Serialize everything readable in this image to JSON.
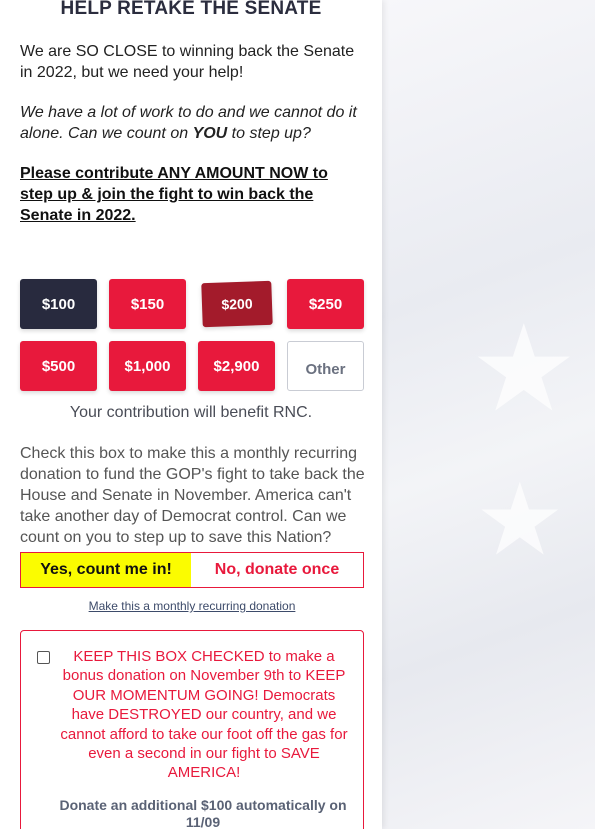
{
  "header": {
    "title": "HELP RETAKE THE SENATE"
  },
  "intro": {
    "paragraph1": "We are SO CLOSE to winning back the Senate in 2022, but we need your help!",
    "paragraph2_pre": "We have a lot of work to do and we cannot do it alone. Can we count on ",
    "paragraph2_you": "YOU",
    "paragraph2_post": " to step up?",
    "cta": "Please contribute ANY AMOUNT NOW to step up & join the fight to win back the Senate in 2022."
  },
  "amounts": {
    "a100": "$100",
    "a150": "$150",
    "a200": "$200",
    "a250": "$250",
    "a500": "$500",
    "a1000": "$1,000",
    "a2900": "$2,900",
    "other": "Other"
  },
  "benefit_text": "Your contribution will benefit RNC.",
  "recurring": {
    "description": "Check this box to make this a monthly recurring donation to fund the GOP's fight to take back the House and Senate in November. America can't take another day of Democrat control. Can we count on you to step up to save this Nation?",
    "yes_label": "Yes, count me in!",
    "no_label": "No, donate once",
    "link": "Make this a monthly recurring donation"
  },
  "bonus": {
    "text": "KEEP THIS BOX CHECKED to make a bonus donation on November 9th to KEEP OUR MOMENTUM GOING! Democrats have DESTROYED our country, and we cannot afford to take our foot off the gas for even a second in our fight to SAVE AMERICA!",
    "sub": "Donate an additional $100 automatically on 11/09"
  },
  "colors": {
    "accent_red": "#e8193c",
    "navy": "#282a3e",
    "yellow": "#fbfc00"
  },
  "icons": {
    "background": "star-icon"
  }
}
